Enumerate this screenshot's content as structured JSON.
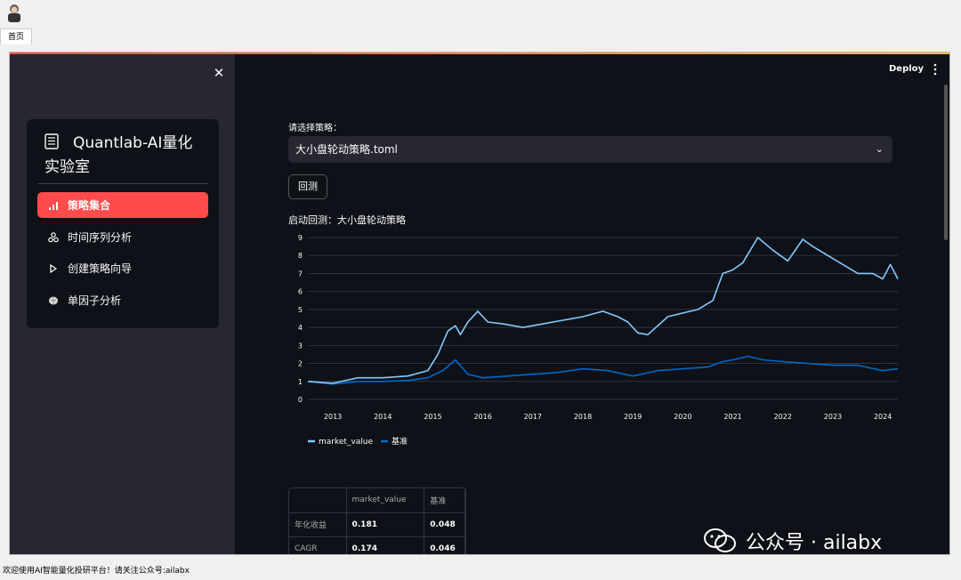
{
  "window": {
    "tab_label": "首页"
  },
  "sidebar": {
    "brand_line1": "Quantlab-AI量化",
    "brand_line2": "实验室",
    "items": [
      {
        "label": "策略集合",
        "icon": "bar-chart-icon",
        "active": true
      },
      {
        "label": "时间序列分析",
        "icon": "molecule-icon",
        "active": false
      },
      {
        "label": "创建策略向导",
        "icon": "play-icon",
        "active": false
      },
      {
        "label": "单因子分析",
        "icon": "brain-icon",
        "active": false
      }
    ]
  },
  "header": {
    "deploy_label": "Deploy"
  },
  "main": {
    "select_label": "请选择策略：",
    "selected_strategy": "大小盘轮动策略.toml",
    "backtest_button": "回测",
    "start_text": "启动回测：大小盘轮动策略"
  },
  "colors": {
    "market_value": "#83c9ff",
    "benchmark": "#0068c9",
    "accent": "#ff4b4b"
  },
  "chart_data": {
    "type": "line",
    "xlim": [
      2012.5,
      2024.3
    ],
    "ylim": [
      0,
      9
    ],
    "xticks": [
      2013,
      2014,
      2015,
      2016,
      2017,
      2018,
      2019,
      2020,
      2021,
      2022,
      2023,
      2024
    ],
    "yticks": [
      0,
      1,
      2,
      3,
      4,
      5,
      6,
      7,
      8,
      9
    ],
    "grid": true,
    "legend_position": "bottom-left",
    "series": [
      {
        "name": "market_value",
        "x": [
          2012.5,
          2013.0,
          2013.5,
          2014.0,
          2014.5,
          2014.9,
          2015.1,
          2015.3,
          2015.45,
          2015.55,
          2015.7,
          2015.9,
          2016.1,
          2016.4,
          2016.8,
          2017.2,
          2017.6,
          2018.0,
          2018.4,
          2018.7,
          2018.9,
          2019.1,
          2019.3,
          2019.7,
          2020.0,
          2020.3,
          2020.6,
          2020.8,
          2021.0,
          2021.2,
          2021.5,
          2021.8,
          2022.1,
          2022.4,
          2022.6,
          2022.9,
          2023.2,
          2023.5,
          2023.8,
          2024.0,
          2024.15,
          2024.3
        ],
        "values": [
          1.0,
          0.9,
          1.2,
          1.2,
          1.3,
          1.6,
          2.5,
          3.8,
          4.1,
          3.6,
          4.3,
          4.9,
          4.3,
          4.2,
          4.0,
          4.2,
          4.4,
          4.6,
          4.9,
          4.6,
          4.3,
          3.7,
          3.6,
          4.6,
          4.8,
          5.0,
          5.5,
          7.0,
          7.2,
          7.6,
          9.0,
          8.3,
          7.7,
          8.9,
          8.5,
          8.0,
          7.5,
          7.0,
          7.0,
          6.7,
          7.5,
          6.7
        ]
      },
      {
        "name": "基准",
        "x": [
          2012.5,
          2013.0,
          2013.5,
          2014.0,
          2014.5,
          2014.9,
          2015.2,
          2015.45,
          2015.7,
          2016.0,
          2016.5,
          2017.0,
          2017.5,
          2018.0,
          2018.5,
          2019.0,
          2019.5,
          2020.0,
          2020.5,
          2020.8,
          2021.0,
          2021.3,
          2021.6,
          2022.0,
          2022.5,
          2023.0,
          2023.5,
          2024.0,
          2024.3
        ],
        "values": [
          1.0,
          0.85,
          1.0,
          1.0,
          1.05,
          1.2,
          1.6,
          2.2,
          1.4,
          1.2,
          1.3,
          1.4,
          1.5,
          1.7,
          1.6,
          1.3,
          1.6,
          1.7,
          1.8,
          2.1,
          2.2,
          2.4,
          2.2,
          2.1,
          2.0,
          1.9,
          1.9,
          1.6,
          1.7
        ]
      }
    ]
  },
  "table": {
    "headers": [
      "",
      "market_value",
      "基准"
    ],
    "rows": [
      {
        "label": "年化收益",
        "market_value": "0.181",
        "benchmark": "0.048"
      },
      {
        "label": "CAGR",
        "market_value": "0.174",
        "benchmark": "0.046"
      }
    ]
  },
  "watermark": {
    "text": "公众号 · ailabx"
  },
  "statusbar": {
    "text": "欢迎使用AI智能量化投研平台！请关注公众号:ailabx"
  }
}
